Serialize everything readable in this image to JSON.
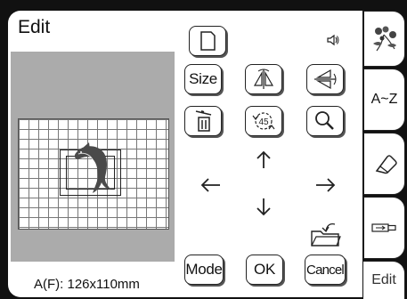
{
  "header": {
    "title": "Edit"
  },
  "preview": {
    "size_label": "A(F): 126x110mm"
  },
  "toolbar": {
    "size_label": "Size",
    "mode_label": "Mode",
    "ok_label": "OK",
    "cancel_label": "Cancel",
    "rotate_label": "45"
  },
  "tabs": {
    "az_label": "A~Z",
    "edit_label": "Edit"
  }
}
